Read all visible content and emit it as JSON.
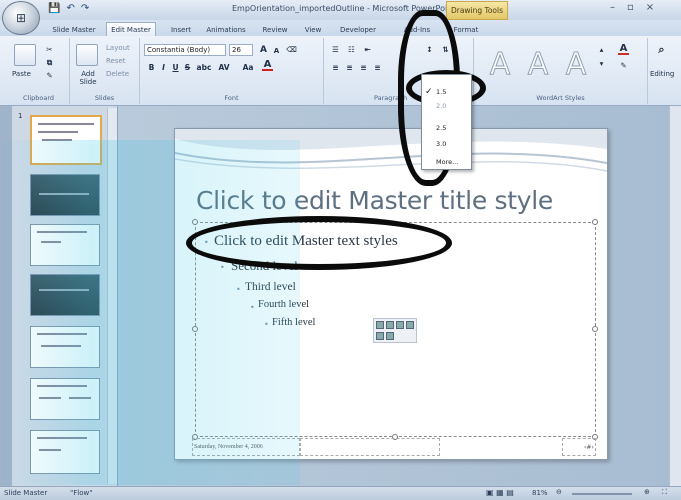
{
  "window": {
    "title": "EmpOrientation_importedOutline - Microsoft PowerPoint",
    "context_tool": "Drawing Tools",
    "controls": [
      "–",
      "▫",
      "×"
    ]
  },
  "qat": {
    "save": "💾",
    "undo": "↶",
    "redo": "↷"
  },
  "tabs": [
    {
      "label": "Slide Master"
    },
    {
      "label": "Edit Master"
    },
    {
      "label": "Insert"
    },
    {
      "label": "Animations"
    },
    {
      "label": "Review"
    },
    {
      "label": "View"
    },
    {
      "label": "Developer"
    },
    {
      "label": "Add-Ins"
    },
    {
      "label": "Format"
    }
  ],
  "ribbon": {
    "clipboard": {
      "label": "Clipboard",
      "paste": "Paste"
    },
    "slides": {
      "label": "Slides",
      "add_slide": "Add Slide",
      "layout": "Layout",
      "reset": "Reset",
      "delete": "Delete"
    },
    "font": {
      "label": "Font",
      "font_name": "Constantia (Body)",
      "font_size": "26",
      "bold": "B",
      "italic": "I",
      "underline": "U",
      "strike": "S",
      "shadow": "abc",
      "spacing": "AV",
      "case": "Aa",
      "color": "A",
      "grow": "A",
      "shrink": "A"
    },
    "paragraph": {
      "label": "Paragraph"
    },
    "wordart": {
      "label": "WordArt Styles",
      "glyph": "A"
    },
    "editing": {
      "label": "Editing"
    }
  },
  "line_spacing_menu": {
    "items": [
      "1.5",
      "2.0",
      "2.5",
      "3.0",
      "More..."
    ],
    "selected": "1.5",
    "checkmark": "✓"
  },
  "slide": {
    "title": "Click to edit Master title style",
    "levels": [
      "Click to edit Master text styles",
      "Second level",
      "Third level",
      "Fourth level",
      "Fifth level"
    ],
    "footer_date": "Saturday, November 4, 2006",
    "slide_number": "‹#›"
  },
  "thumbnails": {
    "count": 7,
    "first_number": "1"
  },
  "status": {
    "view": "Slide Master",
    "theme": "\"Flow\"",
    "zoom": "81%"
  }
}
